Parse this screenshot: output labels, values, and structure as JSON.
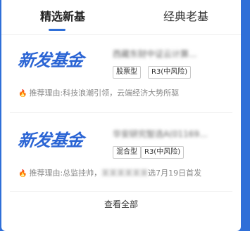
{
  "tabs": [
    {
      "label": "精选新基",
      "active": true
    },
    {
      "label": "经典老基",
      "active": false
    }
  ],
  "funds": [
    {
      "logo_text": "新发基金",
      "name_blurred": "西藏东财中证云计算...",
      "tags": [
        "股票型",
        "R3(中风险)"
      ],
      "reason_prefix": "推荐理由:",
      "reason_text": "科技浪潮引领，云端经济大势所驱",
      "reason_blur": "",
      "reason_tail": ""
    },
    {
      "logo_text": "新发基金",
      "name_blurred": "华安研究智选A(01169...",
      "tags": [
        "混合型",
        "R3(中风险)"
      ],
      "reason_prefix": "推荐理由:",
      "reason_text": "总监挂帅，",
      "reason_blur": "某某某某某某",
      "reason_tail": "选7月19日首发"
    }
  ],
  "footer": {
    "view_all": "查看全部"
  }
}
